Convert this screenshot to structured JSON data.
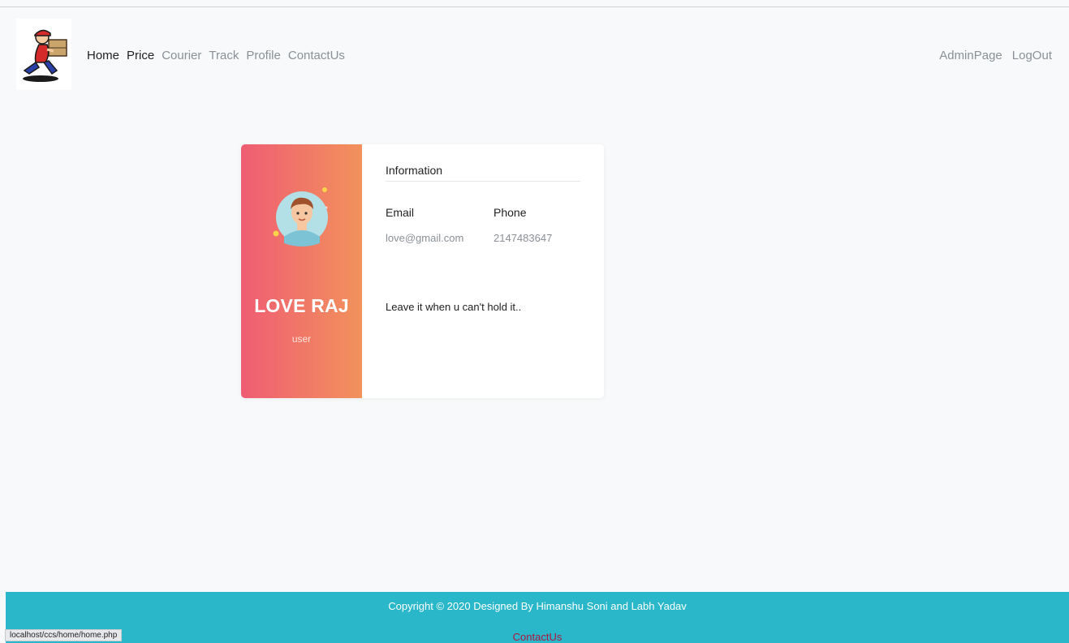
{
  "nav": {
    "links": [
      {
        "label": "Home",
        "active": true
      },
      {
        "label": "Price",
        "active": true
      },
      {
        "label": "Courier",
        "active": false
      },
      {
        "label": "Track",
        "active": false
      },
      {
        "label": "Profile",
        "active": false
      },
      {
        "label": "ContactUs",
        "active": false
      }
    ],
    "right": [
      {
        "label": "AdminPage"
      },
      {
        "label": "LogOut"
      }
    ]
  },
  "profile": {
    "name": "LOVE RAJ",
    "role": "user",
    "info_title": "Information",
    "email_label": "Email",
    "email": "love@gmail.com",
    "phone_label": "Phone",
    "phone": "2147483647",
    "quote": "Leave it when u can't hold it.."
  },
  "footer": {
    "copyright": "Copyright © 2020 Designed By Himanshu Soni and Labh Yadav",
    "link": "ContactUs"
  },
  "status_bar": {
    "url": "localhost/ccs/home/home.php"
  },
  "colors": {
    "footer": "#29b7c9",
    "gradient_start": "#ef5d73",
    "gradient_end": "#f2925c"
  }
}
